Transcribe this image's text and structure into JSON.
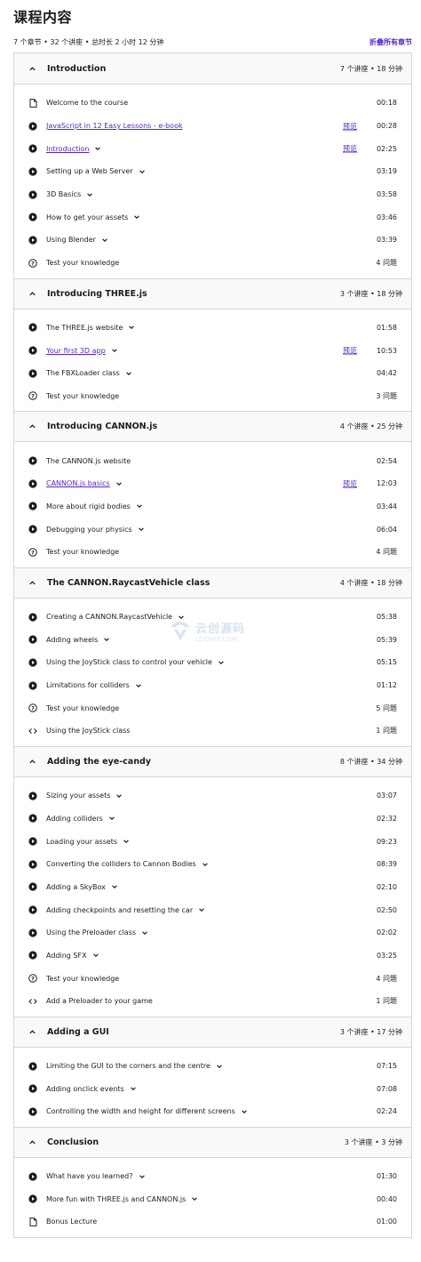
{
  "page": {
    "title": "课程内容",
    "summary": "7 个章节 • 32 个讲座 • 总时长 2 小时 12 分钟",
    "collapse_all": "折叠所有章节",
    "preview_label": "预览"
  },
  "watermark": {
    "cn": "云创源码",
    "en": "LOOWP.COM"
  },
  "colors": {
    "link": "#5624d0",
    "text": "#1c1d1f",
    "border": "#d1d7dc",
    "header_bg": "#f7f9fa"
  },
  "sections": [
    {
      "title": "Introduction",
      "meta": "7 个讲座 • 18 分钟",
      "lectures": [
        {
          "type": "file-icon",
          "title": "Welcome to the course",
          "link": false,
          "chevron": false,
          "preview": false,
          "duration": "00:18"
        },
        {
          "type": "play-icon",
          "title": "JavaScript in 12 Easy Lessons - e-book",
          "link": true,
          "chevron": false,
          "preview": true,
          "duration": "00:28"
        },
        {
          "type": "play-icon",
          "title": "Introduction",
          "link": true,
          "chevron": true,
          "preview": true,
          "duration": "02:25"
        },
        {
          "type": "play-icon",
          "title": "Setting up a Web Server",
          "link": false,
          "chevron": true,
          "preview": false,
          "duration": "03:19"
        },
        {
          "type": "play-icon",
          "title": "3D Basics",
          "link": false,
          "chevron": true,
          "preview": false,
          "duration": "03:58"
        },
        {
          "type": "play-icon",
          "title": "How to get your assets",
          "link": false,
          "chevron": true,
          "preview": false,
          "duration": "03:46"
        },
        {
          "type": "play-icon",
          "title": "Using Blender",
          "link": false,
          "chevron": true,
          "preview": false,
          "duration": "03:39"
        },
        {
          "type": "quiz-icon",
          "title": "Test your knowledge",
          "link": false,
          "chevron": false,
          "preview": false,
          "duration": "4 问题"
        }
      ]
    },
    {
      "title": "Introducing THREE.js",
      "meta": "3 个讲座 • 18 分钟",
      "lectures": [
        {
          "type": "play-icon",
          "title": "The THREE.js website",
          "link": false,
          "chevron": true,
          "preview": false,
          "duration": "01:58"
        },
        {
          "type": "play-icon",
          "title": "Your first 3D app",
          "link": true,
          "chevron": true,
          "preview": true,
          "duration": "10:53"
        },
        {
          "type": "play-icon",
          "title": "The FBXLoader class",
          "link": false,
          "chevron": true,
          "preview": false,
          "duration": "04:42"
        },
        {
          "type": "quiz-icon",
          "title": "Test your knowledge",
          "link": false,
          "chevron": false,
          "preview": false,
          "duration": "3 问题"
        }
      ]
    },
    {
      "title": "Introducing CANNON.js",
      "meta": "4 个讲座 • 25 分钟",
      "lectures": [
        {
          "type": "play-icon",
          "title": "The CANNON.js website",
          "link": false,
          "chevron": false,
          "preview": false,
          "duration": "02:54"
        },
        {
          "type": "play-icon",
          "title": "CANNON.js basics",
          "link": true,
          "chevron": true,
          "preview": true,
          "duration": "12:03"
        },
        {
          "type": "play-icon",
          "title": "More about rigid bodies",
          "link": false,
          "chevron": true,
          "preview": false,
          "duration": "03:44"
        },
        {
          "type": "play-icon",
          "title": "Debugging your physics",
          "link": false,
          "chevron": true,
          "preview": false,
          "duration": "06:04"
        },
        {
          "type": "quiz-icon",
          "title": "Test your knowledge",
          "link": false,
          "chevron": false,
          "preview": false,
          "duration": "4 问题"
        }
      ]
    },
    {
      "title": "The CANNON.RaycastVehicle class",
      "meta": "4 个讲座 • 18 分钟",
      "lectures": [
        {
          "type": "play-icon",
          "title": "Creating a CANNON.RaycastVehicle",
          "link": false,
          "chevron": true,
          "preview": false,
          "duration": "05:38"
        },
        {
          "type": "play-icon",
          "title": "Adding wheels",
          "link": false,
          "chevron": true,
          "preview": false,
          "duration": "05:39"
        },
        {
          "type": "play-icon",
          "title": "Using the JoyStick class to control your vehicle",
          "link": false,
          "chevron": true,
          "preview": false,
          "duration": "05:15"
        },
        {
          "type": "play-icon",
          "title": "Limitations for colliders",
          "link": false,
          "chevron": true,
          "preview": false,
          "duration": "01:12"
        },
        {
          "type": "quiz-icon",
          "title": "Test your knowledge",
          "link": false,
          "chevron": false,
          "preview": false,
          "duration": "5 问题"
        },
        {
          "type": "code-icon",
          "title": "Using the JoyStick class",
          "link": false,
          "chevron": false,
          "preview": false,
          "duration": "1 问题"
        }
      ]
    },
    {
      "title": "Adding the eye-candy",
      "meta": "8 个讲座 • 34 分钟",
      "lectures": [
        {
          "type": "play-icon",
          "title": "Sizing your assets",
          "link": false,
          "chevron": true,
          "preview": false,
          "duration": "03:07"
        },
        {
          "type": "play-icon",
          "title": "Adding colliders",
          "link": false,
          "chevron": true,
          "preview": false,
          "duration": "02:32"
        },
        {
          "type": "play-icon",
          "title": "Loading your assets",
          "link": false,
          "chevron": true,
          "preview": false,
          "duration": "09:23"
        },
        {
          "type": "play-icon",
          "title": "Converting the colliders to Cannon Bodies",
          "link": false,
          "chevron": true,
          "preview": false,
          "duration": "08:39"
        },
        {
          "type": "play-icon",
          "title": "Adding a SkyBox",
          "link": false,
          "chevron": true,
          "preview": false,
          "duration": "02:10"
        },
        {
          "type": "play-icon",
          "title": "Adding checkpoints and resetting the car",
          "link": false,
          "chevron": true,
          "preview": false,
          "duration": "02:50"
        },
        {
          "type": "play-icon",
          "title": "Using the Preloader class",
          "link": false,
          "chevron": true,
          "preview": false,
          "duration": "02:02"
        },
        {
          "type": "play-icon",
          "title": "Adding SFX",
          "link": false,
          "chevron": true,
          "preview": false,
          "duration": "03:25"
        },
        {
          "type": "quiz-icon",
          "title": "Test your knowledge",
          "link": false,
          "chevron": false,
          "preview": false,
          "duration": "4 问题"
        },
        {
          "type": "code-icon",
          "title": "Add a Preloader to your game",
          "link": false,
          "chevron": false,
          "preview": false,
          "duration": "1 问题"
        }
      ]
    },
    {
      "title": "Adding a GUI",
      "meta": "3 个讲座 • 17 分钟",
      "lectures": [
        {
          "type": "play-icon",
          "title": "Limiting the GUI to the corners and the centre",
          "link": false,
          "chevron": true,
          "preview": false,
          "duration": "07:15"
        },
        {
          "type": "play-icon",
          "title": "Adding onclick events",
          "link": false,
          "chevron": true,
          "preview": false,
          "duration": "07:08"
        },
        {
          "type": "play-icon",
          "title": "Controlling the width and height for different screens",
          "link": false,
          "chevron": true,
          "preview": false,
          "duration": "02:24"
        }
      ]
    },
    {
      "title": "Conclusion",
      "meta": "3 个讲座 • 3 分钟",
      "lectures": [
        {
          "type": "play-icon",
          "title": "What have you learned?",
          "link": false,
          "chevron": true,
          "preview": false,
          "duration": "01:30"
        },
        {
          "type": "play-icon",
          "title": "More fun with THREE.js and CANNON.js",
          "link": false,
          "chevron": true,
          "preview": false,
          "duration": "00:40"
        },
        {
          "type": "file-icon",
          "title": "Bonus Lecture",
          "link": false,
          "chevron": false,
          "preview": false,
          "duration": "01:00"
        }
      ]
    }
  ]
}
